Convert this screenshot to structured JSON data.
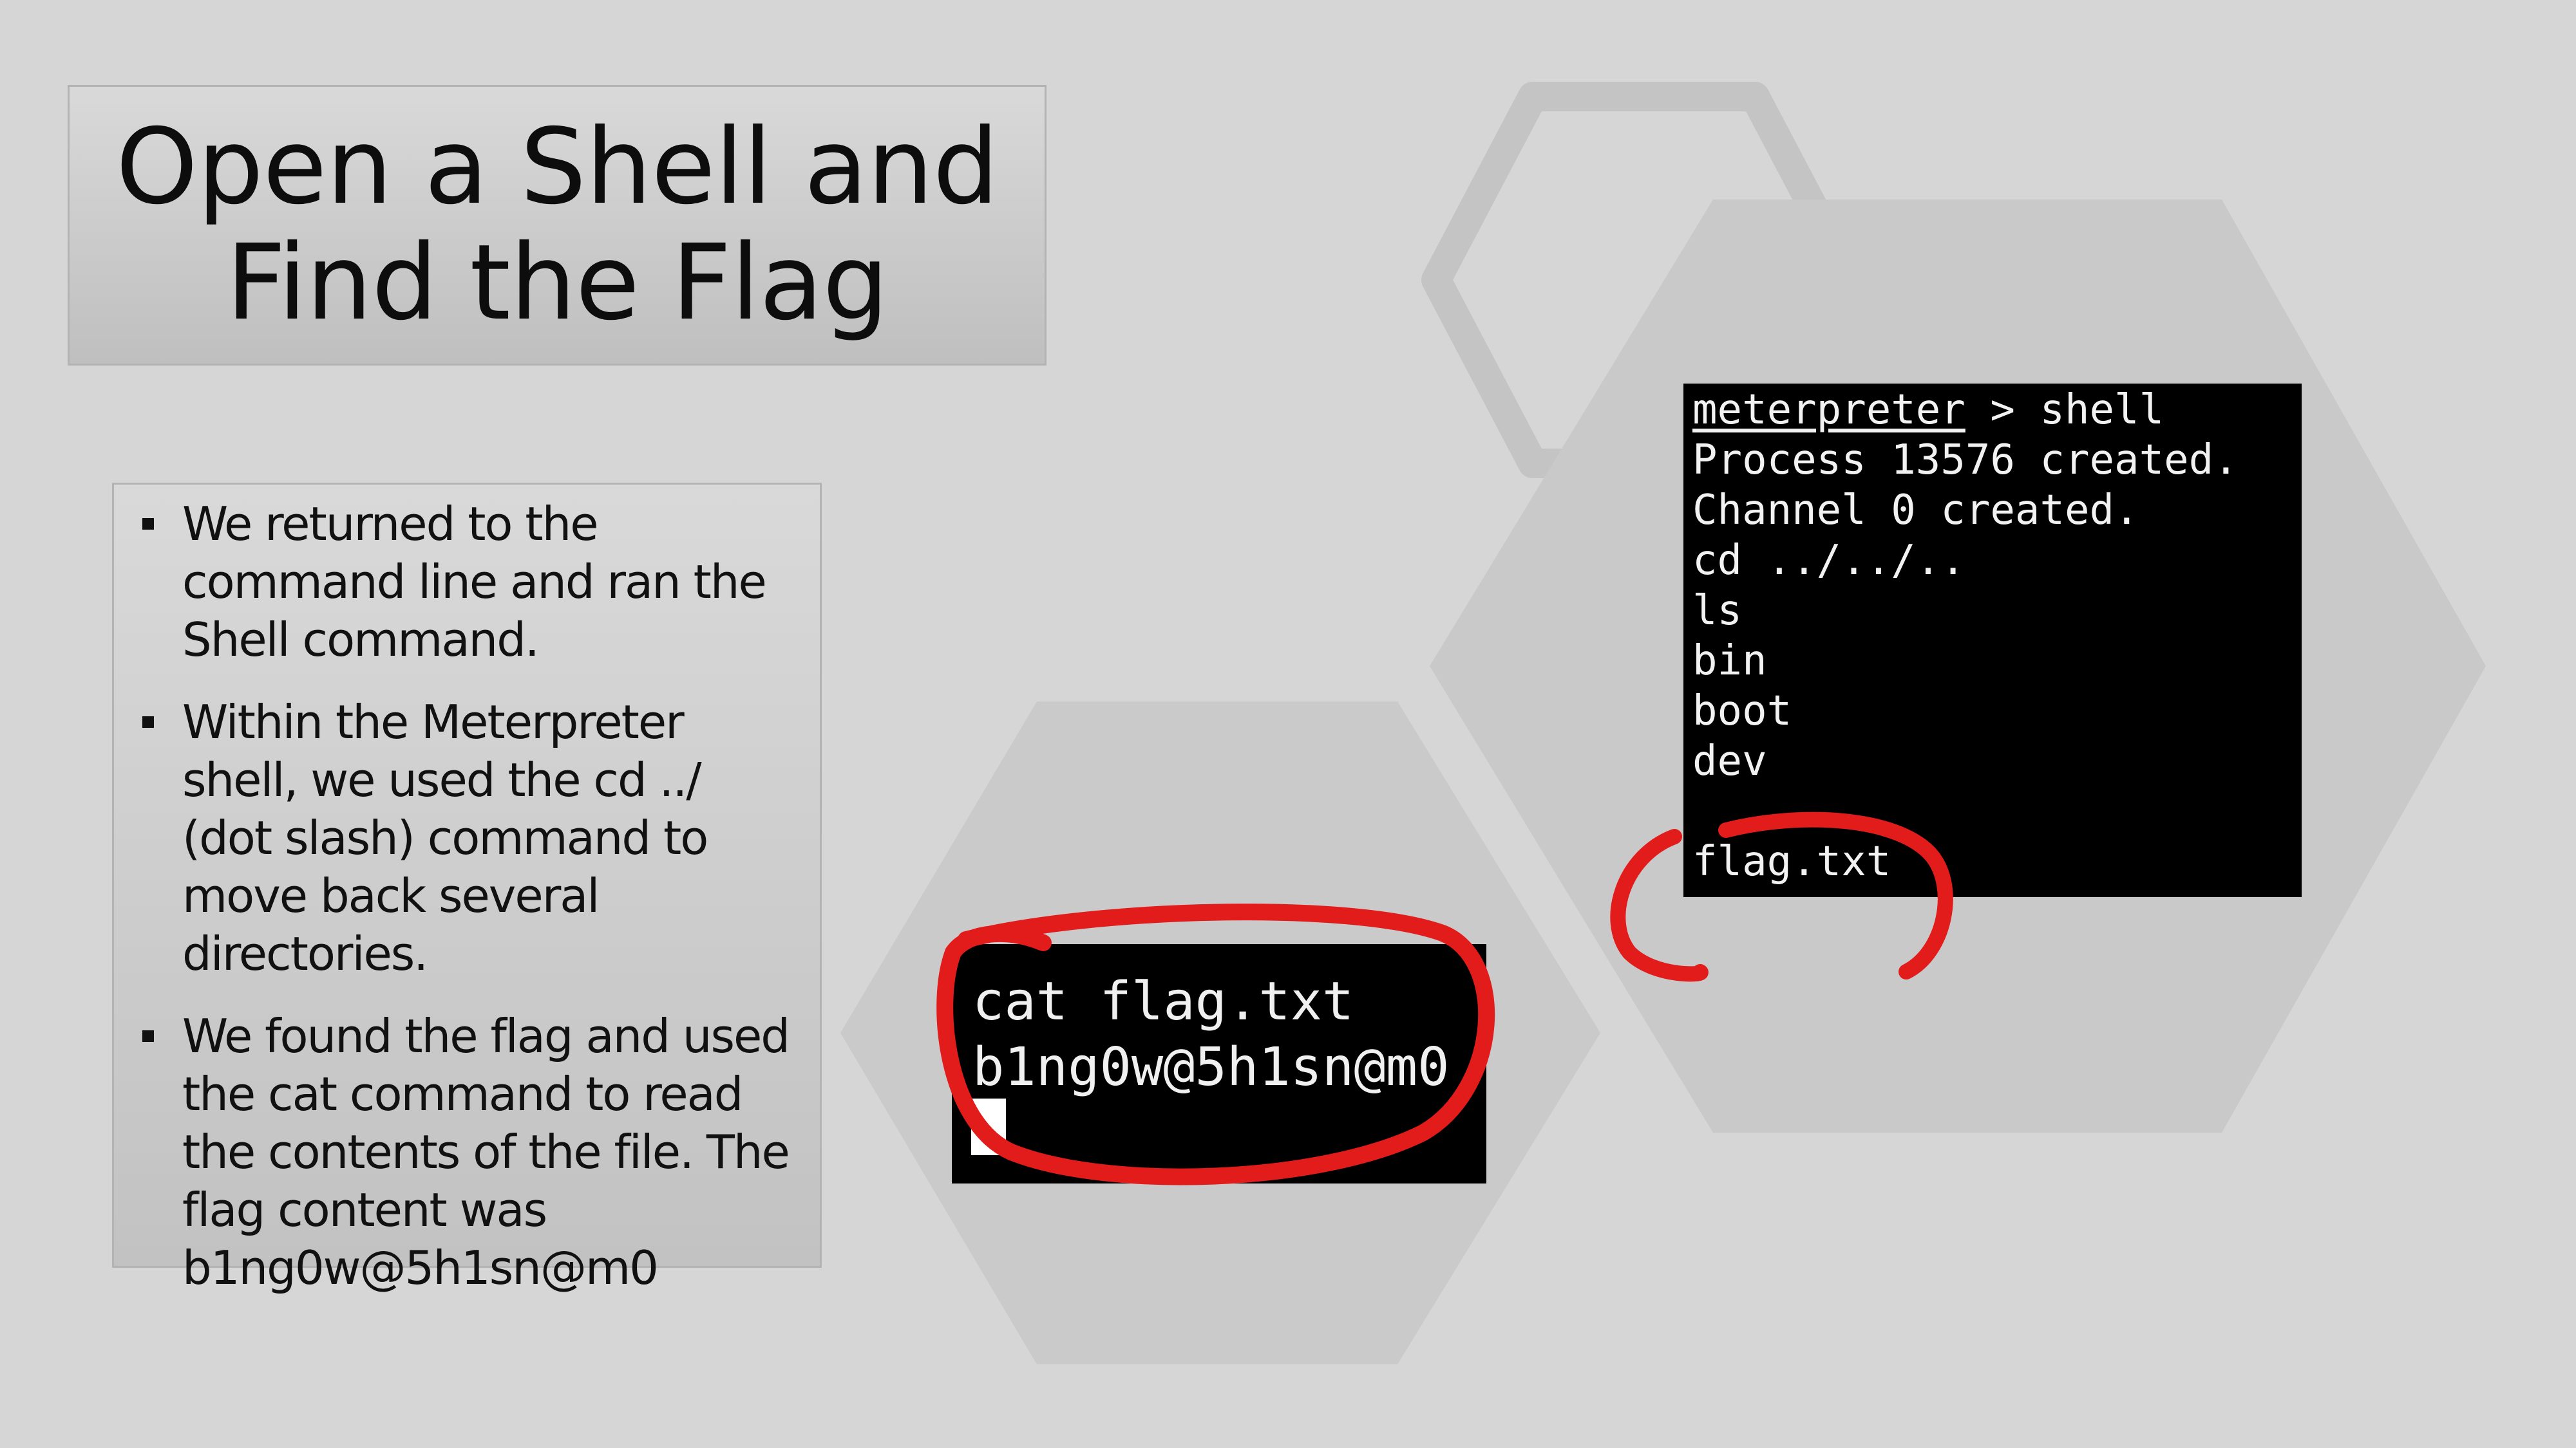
{
  "slide": {
    "title_lines": [
      "Open a Shell and",
      "Find the Flag"
    ],
    "bullets": [
      "We returned to the command line and ran the Shell command.",
      "Within the Meterpreter shell, we used the cd ../ (dot slash) command to move back several directories.",
      "We found the flag and used the cat command to read the contents of the file. The flag content was b1ng0w@5h1sn@m0"
    ]
  },
  "terminal_cat": {
    "lines": [
      "cat flag.txt",
      "b1ng0w@5h1sn@m0"
    ]
  },
  "terminal_shell": {
    "prompt": "meterpreter",
    "prompt_rest": " > shell",
    "lines": [
      "Process 13576 created.",
      "Channel 0 created.",
      "cd ../../..",
      "ls",
      "bin",
      "boot",
      "dev",
      "flag.txt"
    ]
  },
  "colors": {
    "background": "#d6d6d6",
    "hexagon_fill": "#c9c9c9",
    "hexagon_outline": "#c2c2c2",
    "annotation_red": "#e21b1b",
    "terminal_bg": "#000000"
  }
}
